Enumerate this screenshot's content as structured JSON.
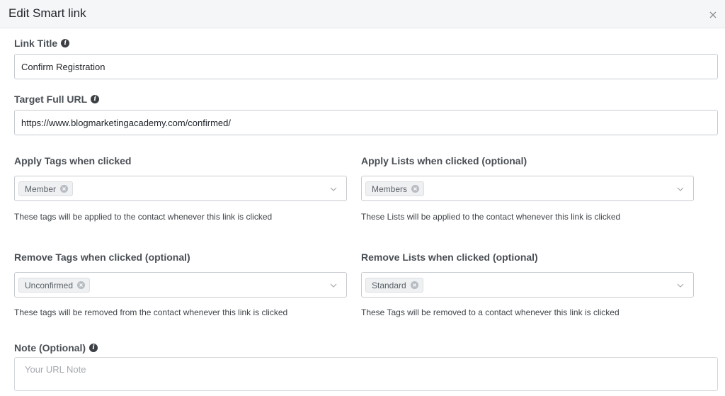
{
  "modal": {
    "title": "Edit Smart link",
    "close_icon": "close-icon"
  },
  "link_title": {
    "label": "Link Title",
    "value": "Confirm Registration"
  },
  "target_url": {
    "label": "Target Full URL",
    "value": "https://www.blogmarketingacademy.com/confirmed/"
  },
  "apply_tags": {
    "label": "Apply Tags when clicked",
    "chip": "Member",
    "help": "These tags will be applied to the contact whenever this link is clicked"
  },
  "apply_lists": {
    "label": "Apply Lists when clicked (optional)",
    "chip": "Members",
    "help": "These Lists will be applied to the contact whenever this link is clicked"
  },
  "remove_tags": {
    "label": "Remove Tags when clicked (optional)",
    "chip": "Unconfirmed",
    "help": "These tags will be removed from the contact whenever this link is clicked"
  },
  "remove_lists": {
    "label": "Remove Lists when clicked (optional)",
    "chip": "Standard",
    "help": "These Tags will be removed to a contact whenever this link is clicked"
  },
  "note": {
    "label": "Note (Optional)",
    "placeholder": "Your URL Note",
    "value": ""
  },
  "colors": {
    "header_bg": "#f5f6f7",
    "border": "#c7cbd0",
    "chip_bg": "#eef0f2",
    "label_text": "#4a4f55"
  }
}
